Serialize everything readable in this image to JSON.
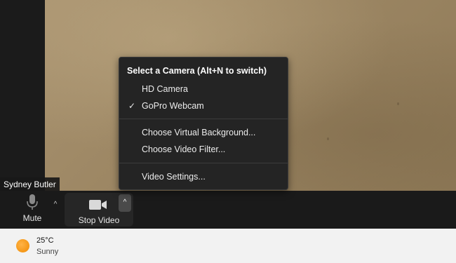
{
  "participant": {
    "name": "Sydney Butler"
  },
  "toolbar": {
    "mute_label": "Mute",
    "stop_video_label": "Stop Video",
    "mute_icon": "microphone-icon",
    "video_icon": "video-camera-icon",
    "caret_glyph": "^"
  },
  "camera_menu": {
    "header": "Select a Camera (Alt+N to switch)",
    "cameras": [
      {
        "label": "HD Camera",
        "selected": false,
        "check": ""
      },
      {
        "label": "GoPro Webcam",
        "selected": true,
        "check": "✓"
      }
    ],
    "options": [
      {
        "label": "Choose Virtual Background..."
      },
      {
        "label": "Choose Video Filter..."
      }
    ],
    "settings_label": "Video Settings..."
  },
  "weather": {
    "temperature": "25°C",
    "condition": "Sunny",
    "icon": "sun-icon"
  },
  "colors": {
    "toolbar_bg": "#1a1a1a",
    "menu_bg": "#242424",
    "sun": "#f08a00"
  }
}
